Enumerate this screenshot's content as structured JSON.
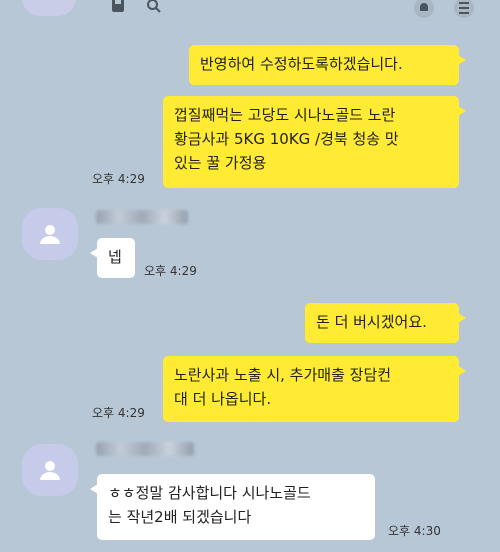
{
  "messages": {
    "m1": "반영하여 수정하도록하겠습니다.",
    "m2_line1": "껍질째먹는 고당도 시나노골드 노란",
    "m2_line2": "황금사과 5KG 10KG /경북 청송 맛",
    "m2_line3": "있는 꿀 가정용",
    "m2_time": "오후 4:29",
    "m3": "넵",
    "m3_time": "오후 4:29",
    "m4": "돈 더 버시겠어요.",
    "m5_line1": "노란사과 노출 시, 추가매출 장담컨",
    "m5_line2": "대 더 나옵니다.",
    "m5_time": "오후 4:29",
    "m6_line1": "ㅎㅎ정말 감사합니다 시나노골드",
    "m6_line2": "는 작년2배 되겠습니다",
    "m6_time": "오후 4:30"
  },
  "icons": [
    "save-icon",
    "search-icon",
    "bell-icon",
    "menu-icon",
    "profile-icon"
  ],
  "colors": {
    "background": "#b8c7d6",
    "my_bubble": "#ffeb33",
    "their_bubble": "#ffffff",
    "avatar": "#c7cbea"
  }
}
